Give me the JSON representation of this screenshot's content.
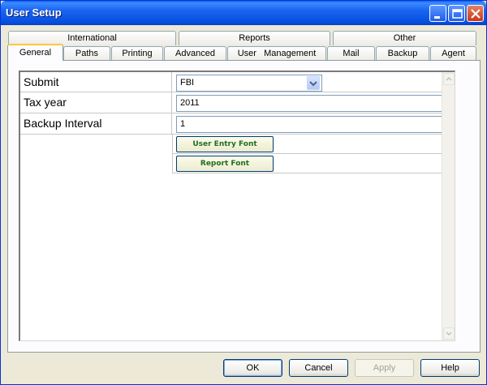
{
  "window": {
    "title": "User Setup"
  },
  "tabs_back": [
    "International",
    "Reports",
    "Other"
  ],
  "tabs_front": [
    "General",
    "Paths",
    "Printing",
    "Advanced",
    "User   Management",
    "Mail",
    "Backup",
    "Agent"
  ],
  "active_tab": "General",
  "settings": {
    "submit": {
      "label": "Submit",
      "value": "FBI"
    },
    "tax_year": {
      "label": "Tax year",
      "value": "2011"
    },
    "backup_interval": {
      "label": "Backup Interval",
      "value": "1"
    },
    "user_entry_font_button": "User Entry Font",
    "report_font_button": "Report Font"
  },
  "buttons": {
    "ok": "OK",
    "cancel": "Cancel",
    "apply": "Apply",
    "help": "Help"
  },
  "colors": {
    "titlebar": "#0a5fef",
    "active_tab_accent": "#ffc83c",
    "font_button_text": "#1f6e1f"
  }
}
